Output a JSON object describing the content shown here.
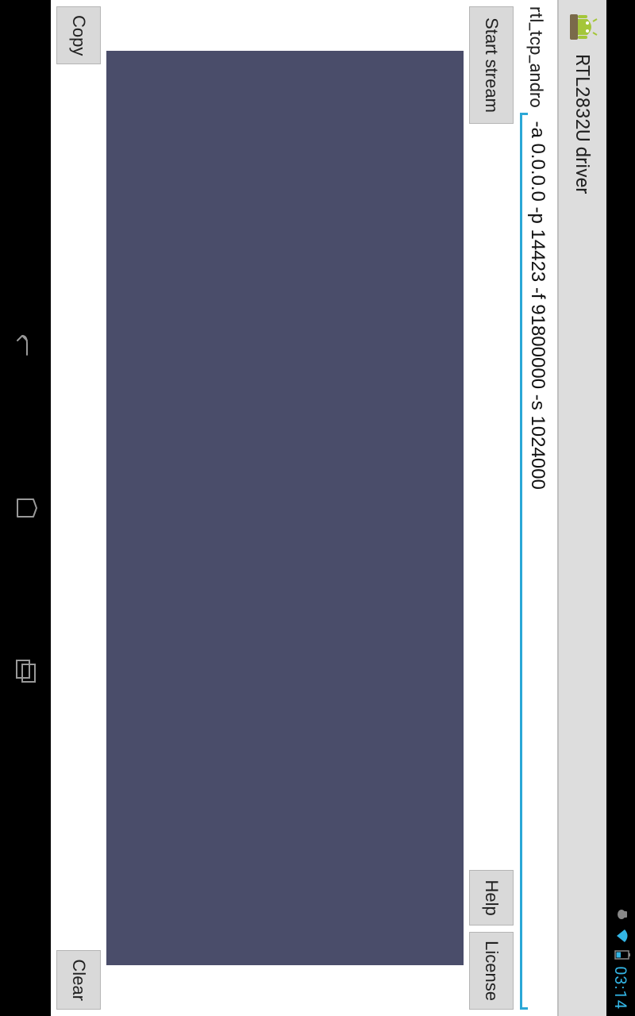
{
  "status": {
    "time": "03:14"
  },
  "title": {
    "app_name": "RTL2832U driver"
  },
  "args": {
    "prefix_label": "rtl_tcp_andro",
    "value": " -a 0.0.0.0 -p 14423 -f 91800000 -s 1024000"
  },
  "buttons": {
    "start": "Start stream",
    "help": "Help",
    "license": "License",
    "copy": "Copy",
    "clear": "Clear"
  },
  "console": {
    "text": ""
  }
}
